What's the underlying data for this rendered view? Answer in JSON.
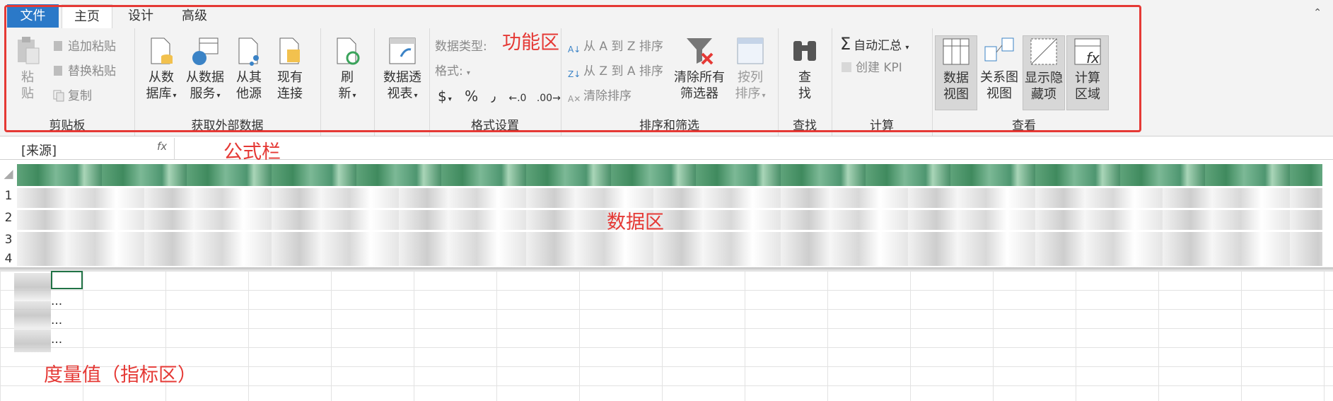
{
  "tabs": {
    "file": "文件",
    "home": "主页",
    "design": "设计",
    "advanced": "高级"
  },
  "ribbon": {
    "clipboard": {
      "paste": [
        "粘",
        "贴"
      ],
      "append_paste": "追加粘贴",
      "replace_paste": "替换粘贴",
      "copy": "复制",
      "label": "剪贴板"
    },
    "external": {
      "from_db": [
        "从数",
        "据库"
      ],
      "from_service": [
        "从数据",
        "服务"
      ],
      "from_other": [
        "从其",
        "他源"
      ],
      "existing": [
        "现有",
        "连接"
      ],
      "label": "获取外部数据"
    },
    "refresh": [
      "刷",
      "新"
    ],
    "pivot": [
      "数据透",
      "视表"
    ],
    "format": {
      "data_type": "数据类型:",
      "format": "格式:",
      "currency": "$",
      "percent": "%",
      "comma": "٫",
      "inc_decimal": "←.0",
      "dec_decimal": ".00→",
      "label": "格式设置"
    },
    "sort": {
      "a_to_z": "从 A 到 Z 排序",
      "z_to_a": "从 Z 到 A 排序",
      "clear_sort": "清除排序",
      "clear_filters": [
        "清除所有",
        "筛选器"
      ],
      "sort_by_column": [
        "按列",
        "排序"
      ],
      "label": "排序和筛选"
    },
    "find": {
      "btn": [
        "查",
        "找"
      ],
      "label": "查找"
    },
    "calc": {
      "autosum": "自动汇总",
      "create_kpi": "创建 KPI",
      "label": "计算"
    },
    "view": {
      "data_view": [
        "数据",
        "视图"
      ],
      "diagram_view": [
        "关系图",
        "视图"
      ],
      "show_hidden": [
        "显示隐",
        "藏项"
      ],
      "calc_area": [
        "计算",
        "区域"
      ],
      "label": "查看"
    }
  },
  "formula_bar": {
    "name_box": "[来源]",
    "fx": "fx"
  },
  "row_numbers": [
    "1",
    "2",
    "3",
    "4"
  ],
  "ellipsis": [
    "...",
    "...",
    "..."
  ],
  "annotations": {
    "function_area": "功能区",
    "formula_bar": "公式栏",
    "data_area": "数据区",
    "measures_area": "度量值（指标区）"
  },
  "colors": {
    "accent": "#2b79c8",
    "annotation": "#e53935",
    "header_green": "#4e9670"
  }
}
